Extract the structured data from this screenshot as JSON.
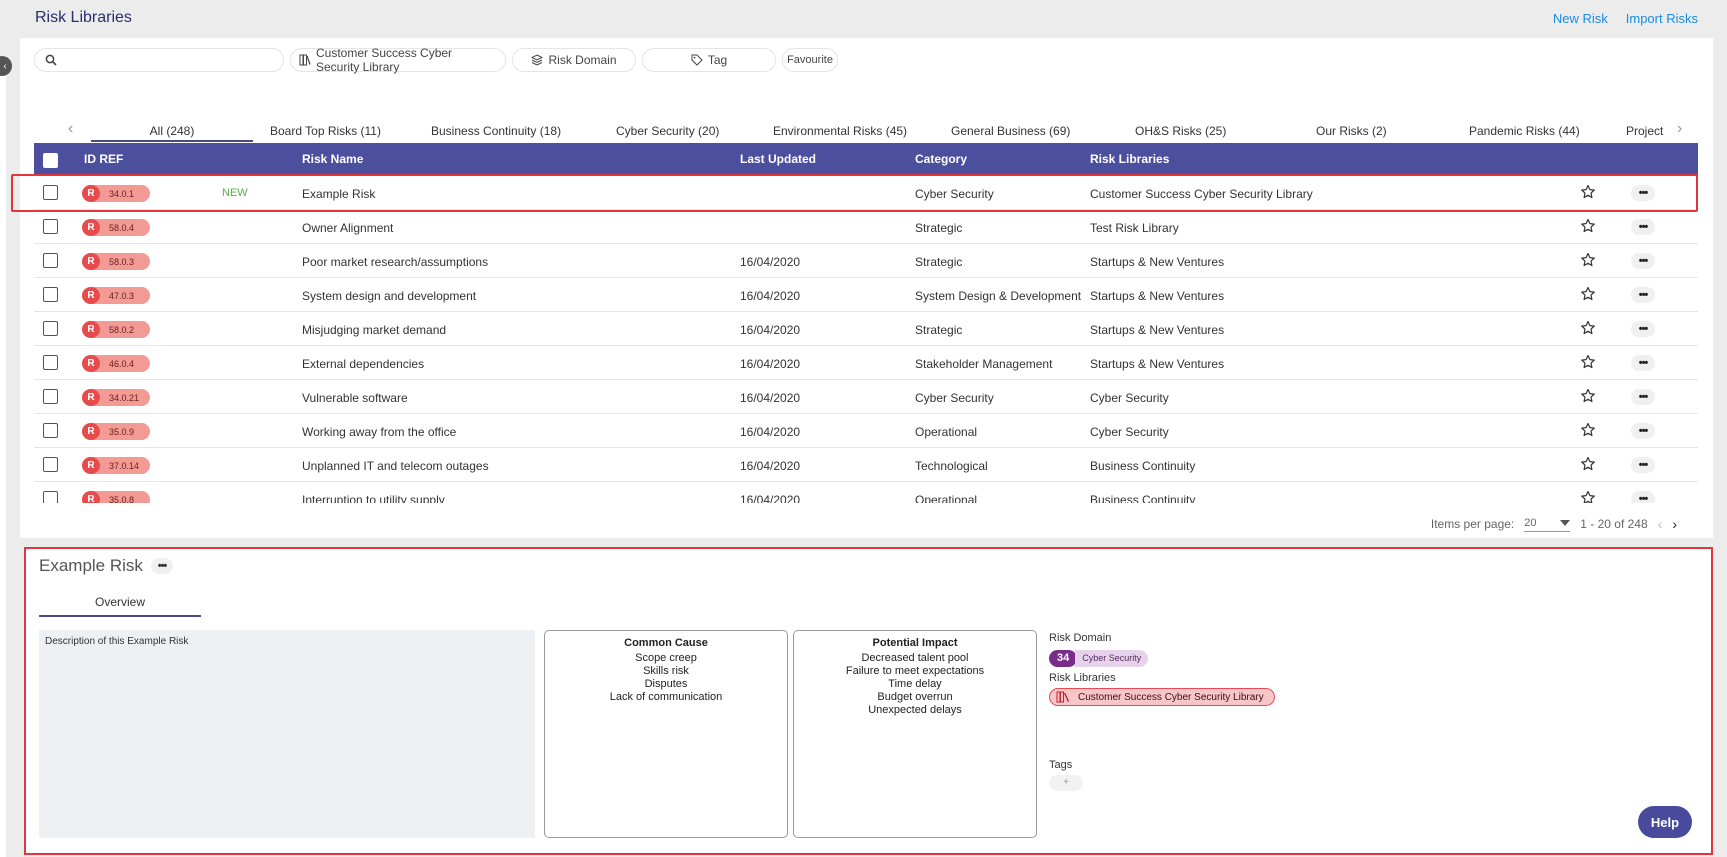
{
  "header": {
    "title": "Risk Libraries",
    "actions": [
      "New Risk",
      "Import Risks"
    ]
  },
  "filters": {
    "search_placeholder": "",
    "library": "Customer Success Cyber Security Library",
    "domain": "Risk Domain",
    "tag": "Tag",
    "favourite": "Favourite"
  },
  "tabs": [
    {
      "label": "All (248)",
      "active": true
    },
    {
      "label": "Board Top Risks (11)"
    },
    {
      "label": "Business Continuity (18)"
    },
    {
      "label": "Cyber Security (20)"
    },
    {
      "label": "Environmental Risks (45)"
    },
    {
      "label": "General Business (69)"
    },
    {
      "label": "OH&S Risks (25)"
    },
    {
      "label": "Our Risks (2)"
    },
    {
      "label": "Pandemic Risks (44)"
    },
    {
      "label": "Project"
    }
  ],
  "table": {
    "columns": [
      "ID REF",
      "Risk Name",
      "Last Updated",
      "Category",
      "Risk Libraries"
    ],
    "badge_letter": "R",
    "new_label": "NEW",
    "rows": [
      {
        "ref": "34.0.1",
        "new": true,
        "name": "Example Risk",
        "updated": "",
        "category": "Cyber Security",
        "library": "Customer Success Cyber Security Library"
      },
      {
        "ref": "58.0.4",
        "name": "Owner Alignment",
        "updated": "",
        "category": "Strategic",
        "library": "Test Risk Library"
      },
      {
        "ref": "58.0.3",
        "name": "Poor market research/assumptions",
        "updated": "16/04/2020",
        "category": "Strategic",
        "library": "Startups & New Ventures"
      },
      {
        "ref": "47.0.3",
        "name": "System design and development",
        "updated": "16/04/2020",
        "category": "System Design & Development",
        "library": "Startups & New Ventures"
      },
      {
        "ref": "58.0.2",
        "name": "Misjudging market demand",
        "updated": "16/04/2020",
        "category": "Strategic",
        "library": "Startups & New Ventures"
      },
      {
        "ref": "46.0.4",
        "name": "External dependencies",
        "updated": "16/04/2020",
        "category": "Stakeholder Management",
        "library": "Startups & New Ventures"
      },
      {
        "ref": "34.0.21",
        "name": "Vulnerable software",
        "updated": "16/04/2020",
        "category": "Cyber Security",
        "library": "Cyber Security"
      },
      {
        "ref": "35.0.9",
        "name": "Working away from the office",
        "updated": "16/04/2020",
        "category": "Operational",
        "library": "Cyber Security"
      },
      {
        "ref": "37.0.14",
        "name": "Unplanned IT and telecom outages",
        "updated": "16/04/2020",
        "category": "Technological",
        "library": "Business Continuity"
      },
      {
        "ref": "35.0.8",
        "name": "Interruption to utility supply",
        "updated": "16/04/2020",
        "category": "Operational",
        "library": "Business Continuity"
      }
    ]
  },
  "pager": {
    "label": "Items per page:",
    "per_page": "20",
    "range": "1 - 20 of 248"
  },
  "detail": {
    "title": "Example Risk",
    "tab": "Overview",
    "description": "Description of this Example Risk",
    "common_cause": {
      "title": "Common Cause",
      "items": [
        "Scope creep",
        "Skills risk",
        "Disputes",
        "Lack of communication"
      ]
    },
    "potential_impact": {
      "title": "Potential Impact",
      "items": [
        "Decreased talent pool",
        "Failure to meet expectations",
        "Time delay",
        "Budget overrun",
        "Unexpected delays"
      ]
    },
    "risk_domain_label": "Risk Domain",
    "domain_number": "34",
    "domain_name": "Cyber Security",
    "risk_libraries_label": "Risk Libraries",
    "library_name": "Customer Success Cyber Security Library",
    "tags_label": "Tags",
    "tag_add": "+"
  },
  "help": "Help",
  "colors": {
    "header_bg": "#4c4f9e",
    "highlight": "#e3363c",
    "link": "#1b8be0",
    "new": "#53b33f"
  }
}
